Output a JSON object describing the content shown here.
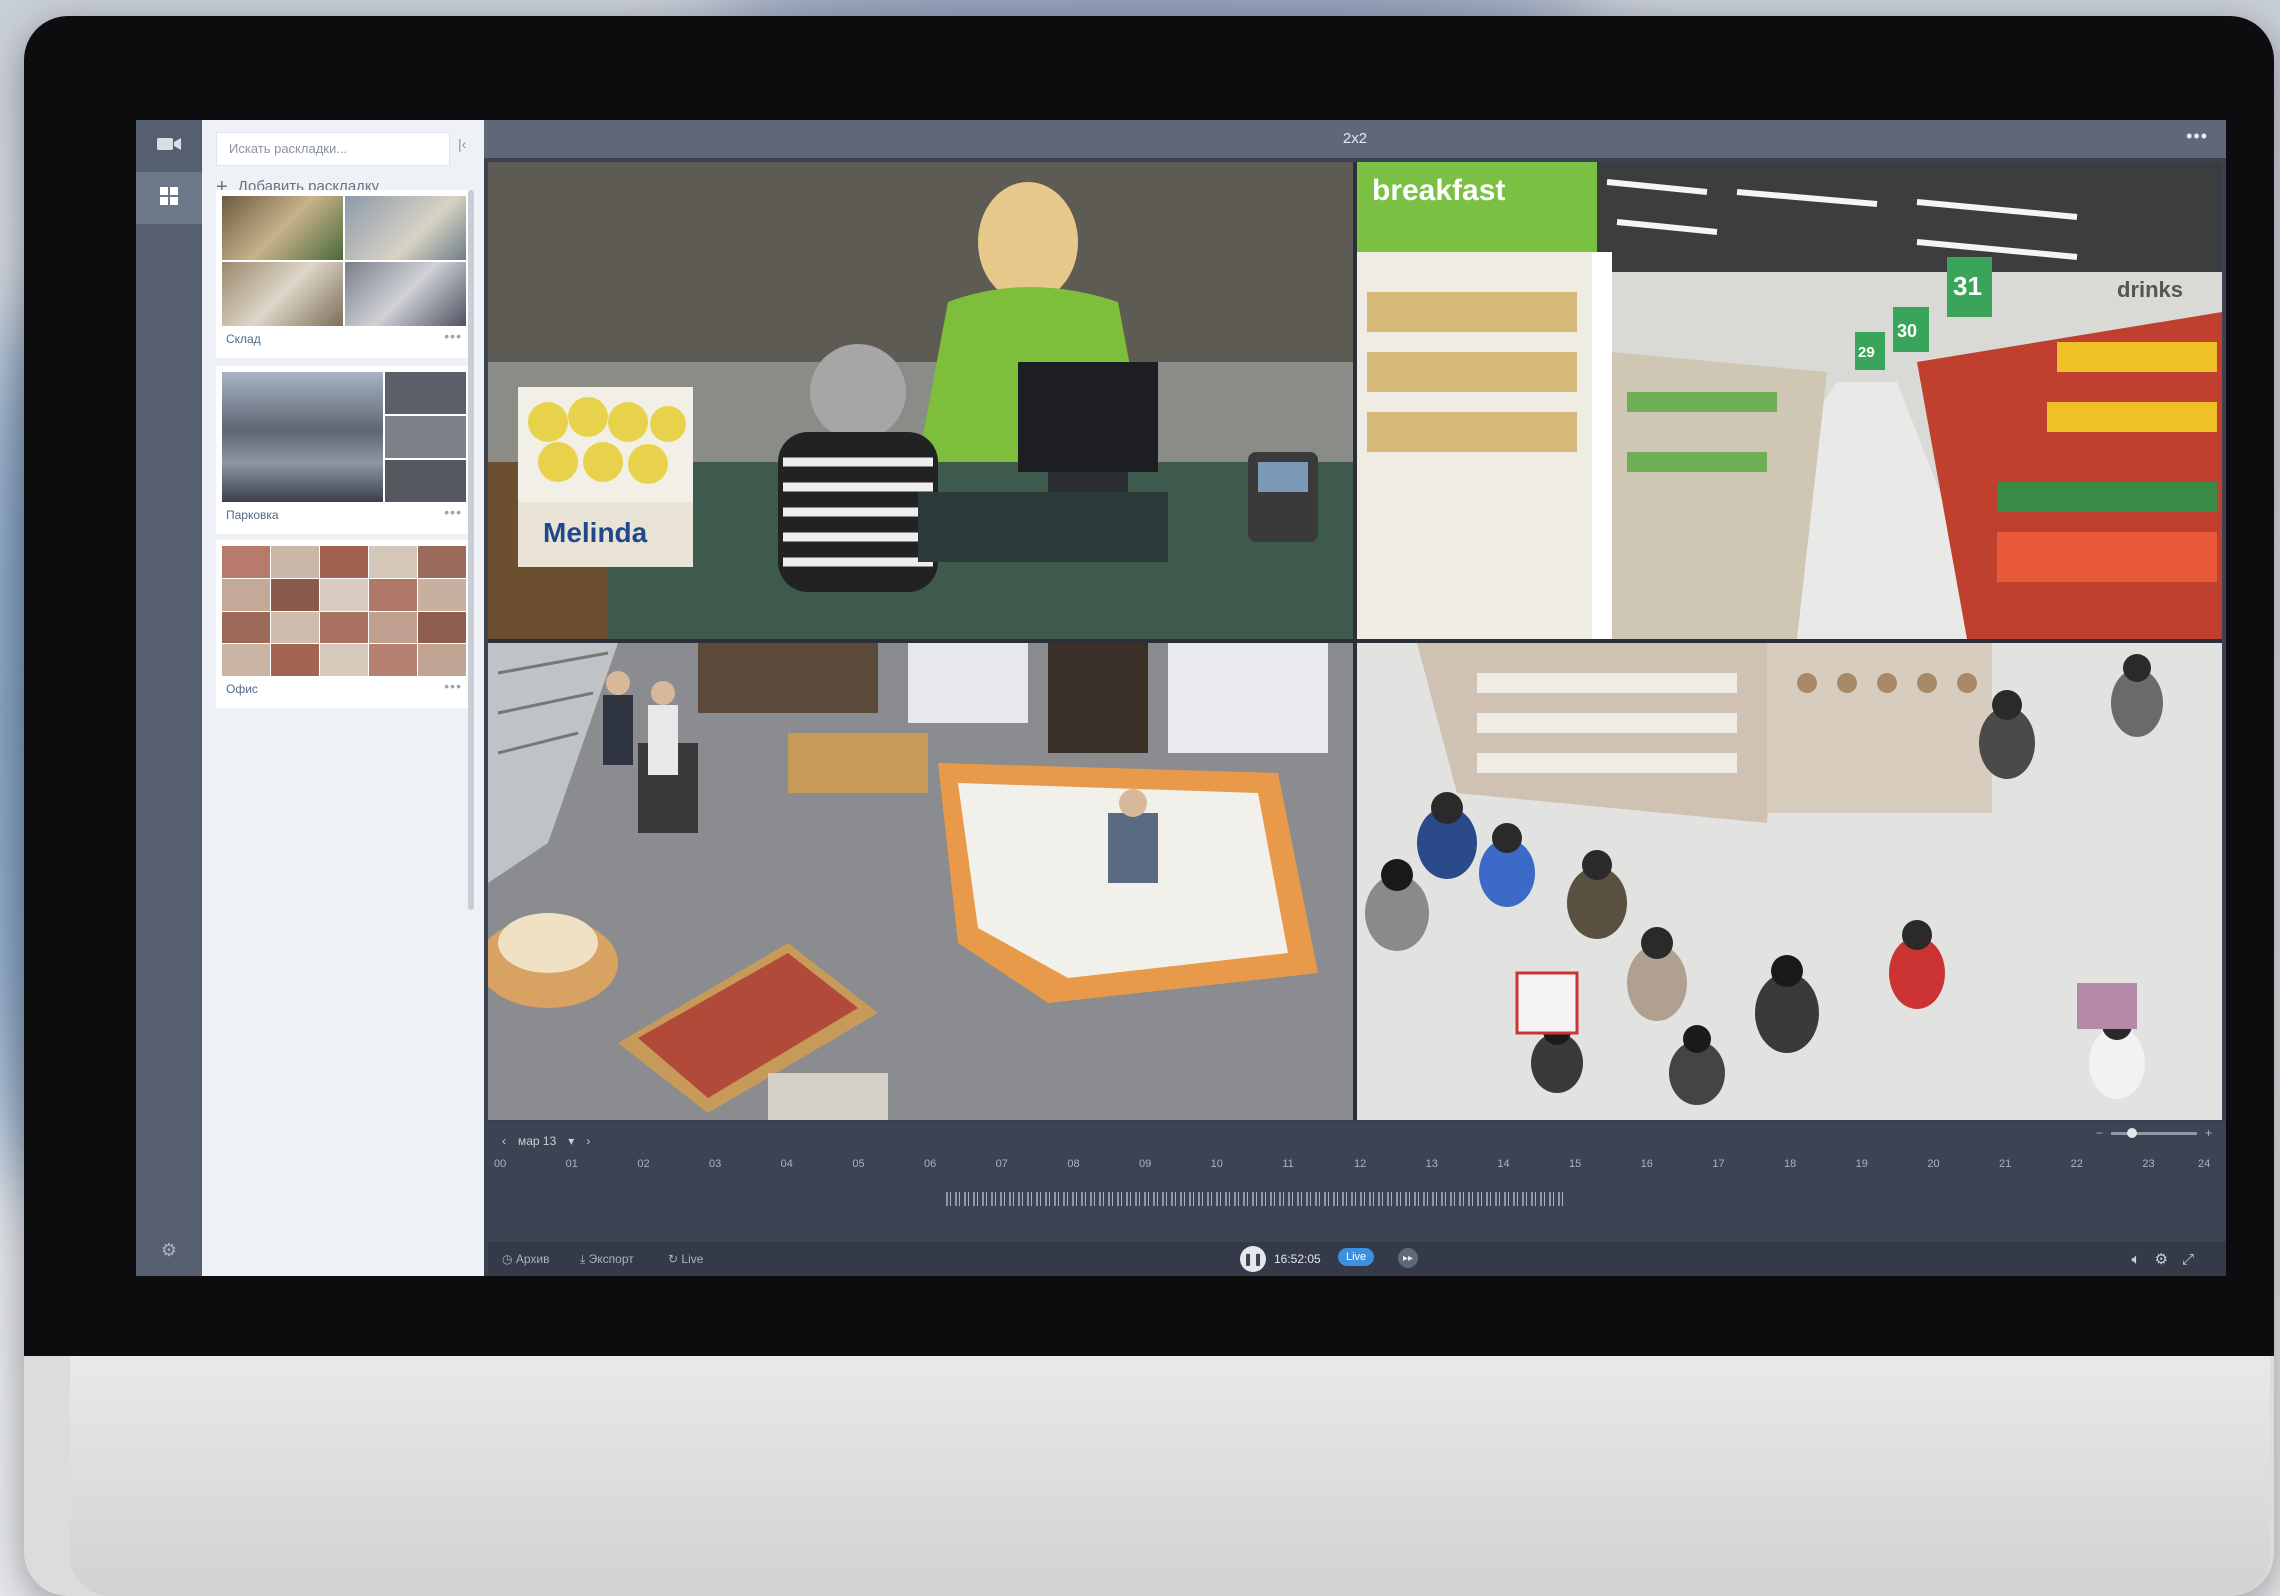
{
  "app": {
    "layout_title": "2x2",
    "more_label": "•••"
  },
  "sidebar": {
    "search_placeholder": "Искать раскладки...",
    "add_layout_label": "Добавить раскладку",
    "layouts": [
      {
        "name": "Склад",
        "menu": "•••"
      },
      {
        "name": "Парковка",
        "menu": "•••"
      },
      {
        "name": "Офис",
        "menu": "•••"
      }
    ]
  },
  "cameras": [
    {
      "scene": "checkout-counter"
    },
    {
      "scene": "supermarket-aisles"
    },
    {
      "scene": "bookstore-floor"
    },
    {
      "scene": "crowd-at-store"
    }
  ],
  "camera_text": {
    "breakfast_sign": "breakfast",
    "melinda_box": "Melinda",
    "aisle_number_1": "31",
    "aisle_number_2": "30",
    "aisle_number_3": "29",
    "drinks_sign": "drinks"
  },
  "timeline": {
    "date_label": "мар 13",
    "hours": [
      "00",
      "01",
      "02",
      "03",
      "04",
      "05",
      "06",
      "07",
      "08",
      "09",
      "10",
      "11",
      "12",
      "13",
      "14",
      "15",
      "16",
      "17",
      "18",
      "19",
      "20",
      "21",
      "22",
      "23",
      "24"
    ],
    "archive_label": "Архив",
    "export_label": "Экспорт",
    "live_btn_label": "Live",
    "current_time": "16:52:05",
    "live_badge": "Live",
    "zoom_minus": "−",
    "zoom_plus": "+"
  },
  "colors": {
    "rail": "#555f70",
    "panel": "#eef1f5",
    "topbar": "#5f6879",
    "accent": "#3d8fe0"
  }
}
